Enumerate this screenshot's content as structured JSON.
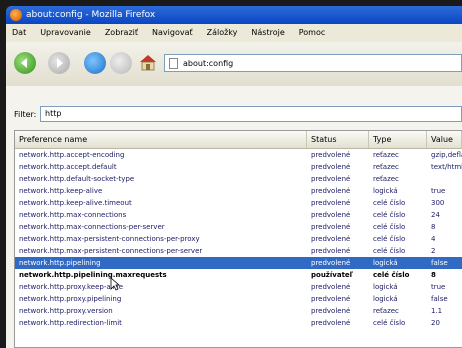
{
  "window": {
    "title": "about:config - Mozilla Firefox"
  },
  "menubar": [
    "Dat",
    "Upravovanie",
    "Zobraziť",
    "Navigovať",
    "Záložky",
    "Nástroje",
    "Pomoc"
  ],
  "navbar": {
    "url": "about:config"
  },
  "filter": {
    "label": "Filter:",
    "value": "http"
  },
  "table": {
    "columns": [
      "Preference name",
      "Status",
      "Type",
      "Value"
    ],
    "rows": [
      {
        "name": "network.http.accept-encoding",
        "status": "predvolené",
        "type": "reťazec",
        "value": "gzip,deflate",
        "selected": false,
        "bold": false
      },
      {
        "name": "network.http.accept.default",
        "status": "predvolené",
        "type": "reťazec",
        "value": "text/html",
        "selected": false,
        "bold": false
      },
      {
        "name": "network.http.default-socket-type",
        "status": "predvolené",
        "type": "reťazec",
        "value": "",
        "selected": false,
        "bold": false
      },
      {
        "name": "network.http.keep-alive",
        "status": "predvolené",
        "type": "logická",
        "value": "true",
        "selected": false,
        "bold": false
      },
      {
        "name": "network.http.keep-alive.timeout",
        "status": "predvolené",
        "type": "celé číslo",
        "value": "300",
        "selected": false,
        "bold": false
      },
      {
        "name": "network.http.max-connections",
        "status": "predvolené",
        "type": "celé číslo",
        "value": "24",
        "selected": false,
        "bold": false
      },
      {
        "name": "network.http.max-connections-per-server",
        "status": "predvolené",
        "type": "celé číslo",
        "value": "8",
        "selected": false,
        "bold": false
      },
      {
        "name": "network.http.max-persistent-connections-per-proxy",
        "status": "predvolené",
        "type": "celé číslo",
        "value": "4",
        "selected": false,
        "bold": false
      },
      {
        "name": "network.http.max-persistent-connections-per-server",
        "status": "predvolené",
        "type": "celé číslo",
        "value": "2",
        "selected": false,
        "bold": false
      },
      {
        "name": "network.http.pipelining",
        "status": "predvolené",
        "type": "logická",
        "value": "false",
        "selected": true,
        "bold": false
      },
      {
        "name": "network.http.pipelining.maxrequests",
        "status": "používateľ",
        "type": "celé číslo",
        "value": "8",
        "selected": false,
        "bold": true
      },
      {
        "name": "network.http.proxy.keep-alive",
        "status": "predvolené",
        "type": "logická",
        "value": "true",
        "selected": false,
        "bold": false
      },
      {
        "name": "network.http.proxy.pipelining",
        "status": "predvolené",
        "type": "logická",
        "value": "false",
        "selected": false,
        "bold": false
      },
      {
        "name": "network.http.proxy.version",
        "status": "predvolené",
        "type": "reťazec",
        "value": "1.1",
        "selected": false,
        "bold": false
      },
      {
        "name": "network.http.redirection-limit",
        "status": "predvolené",
        "type": "celé číslo",
        "value": "20",
        "selected": false,
        "bold": false
      }
    ]
  }
}
